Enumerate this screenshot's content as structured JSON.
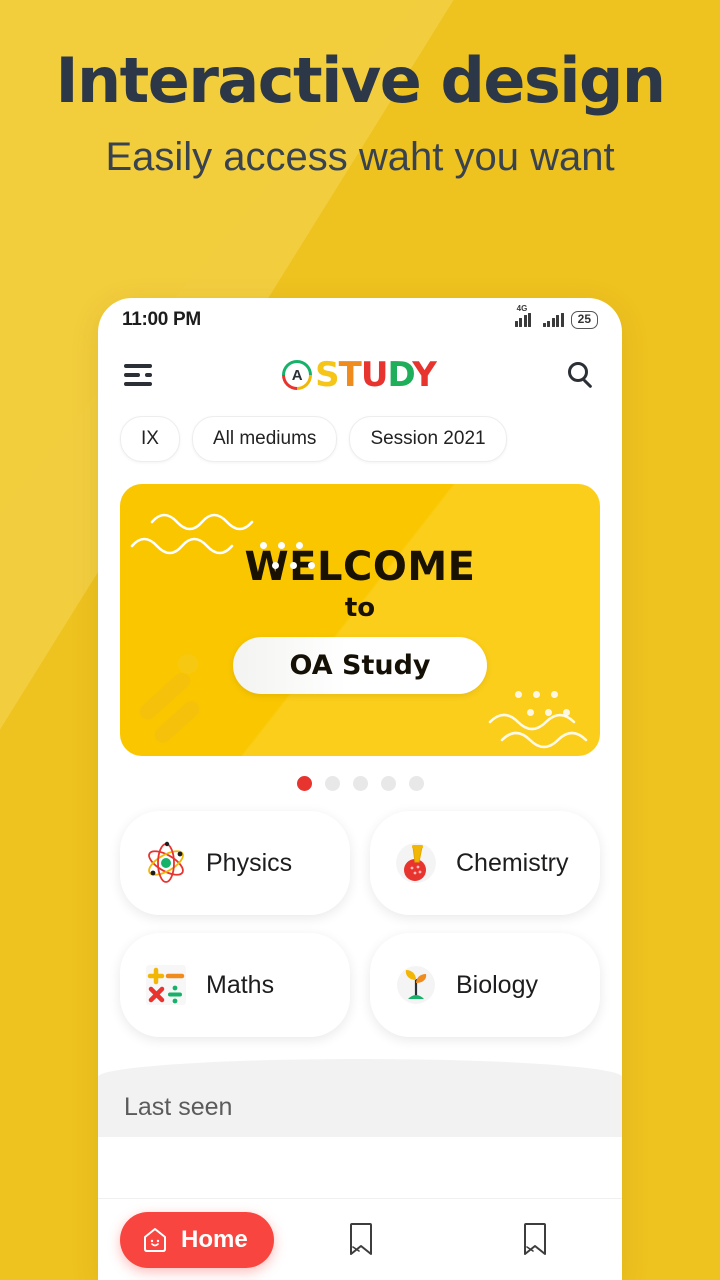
{
  "promo": {
    "headline": "Interactive design",
    "subheadline": "Easily access waht you want",
    "bg_color_light": "#f2ce3f",
    "bg_color_dark": "#eec21f"
  },
  "phone": {
    "statusbar": {
      "time": "11:00 PM",
      "network_label": "4G",
      "battery_level": "25"
    },
    "appbar": {
      "menu_icon": "hamburger-menu-icon",
      "search_icon": "search-icon",
      "brand_mark": "oa-study-logo-mark",
      "brand_letters": [
        {
          "char": "S",
          "color": "#f5c518"
        },
        {
          "char": "T",
          "color": "#f08c1e"
        },
        {
          "char": "U",
          "color": "#e8342f"
        },
        {
          "char": "D",
          "color": "#1fae5a"
        },
        {
          "char": "Y",
          "color": "#e8342f"
        }
      ]
    },
    "filters": [
      {
        "label": "IX"
      },
      {
        "label": "All mediums"
      },
      {
        "label": "Session 2021"
      }
    ],
    "banner": {
      "line1": "WELCOME",
      "line2": "to",
      "pill": "OA Study",
      "bg_color": "#f9c600"
    },
    "carousel": {
      "total": 5,
      "active_index": 0,
      "active_color": "#e8342f",
      "inactive_color": "#e8e8e8"
    },
    "subjects": [
      {
        "label": "Physics",
        "icon": "atom-icon"
      },
      {
        "label": "Chemistry",
        "icon": "flask-icon"
      },
      {
        "label": "Maths",
        "icon": "math-symbols-icon"
      },
      {
        "label": "Biology",
        "icon": "sprout-icon"
      }
    ],
    "sections": {
      "last_seen_title": "Last seen"
    },
    "bottom_nav": [
      {
        "label": "Home",
        "icon": "home-icon",
        "active": true,
        "color": "#f9453f"
      },
      {
        "label": "",
        "icon": "bookmark-icon",
        "active": false,
        "color": "#3d3d3d"
      },
      {
        "label": "",
        "icon": "bookmark-icon",
        "active": false,
        "color": "#3d3d3d"
      }
    ]
  }
}
